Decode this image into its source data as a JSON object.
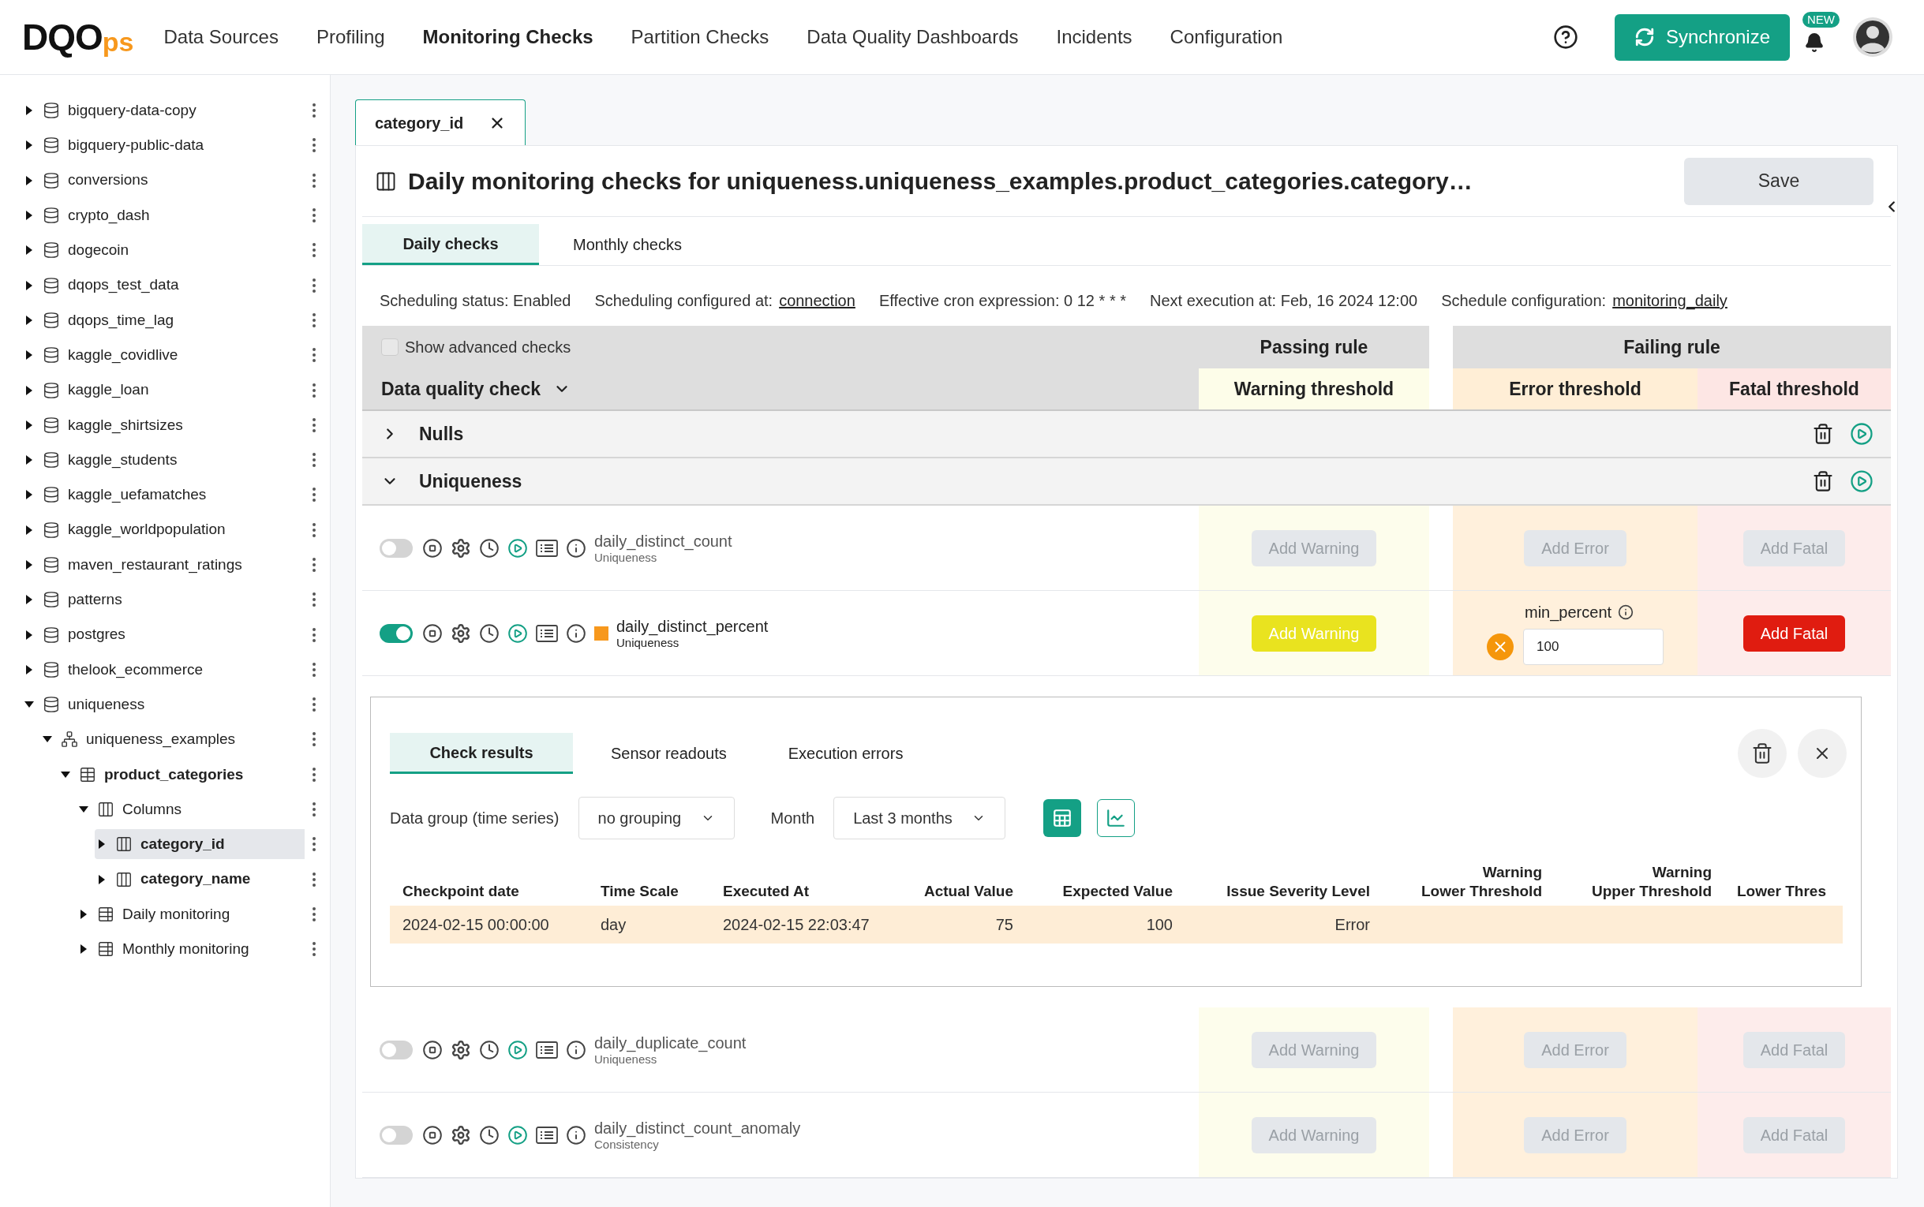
{
  "header": {
    "logo": {
      "text": "DQO",
      "suffix": "ps"
    },
    "nav": [
      {
        "label": "Data Sources",
        "selected": false
      },
      {
        "label": "Profiling",
        "selected": false
      },
      {
        "label": "Monitoring Checks",
        "selected": true
      },
      {
        "label": "Partition Checks",
        "selected": false
      },
      {
        "label": "Data Quality Dashboards",
        "selected": false
      },
      {
        "label": "Incidents",
        "selected": false
      },
      {
        "label": "Configuration",
        "selected": false
      }
    ],
    "sync_button": "Synchronize",
    "badge": "NEW"
  },
  "sidebar": {
    "items": [
      {
        "label": "bigquery-data-copy",
        "kind": "database",
        "expanded": false,
        "selected": false
      },
      {
        "label": "bigquery-public-data",
        "kind": "database",
        "expanded": false,
        "selected": false
      },
      {
        "label": "conversions",
        "kind": "database",
        "expanded": false,
        "selected": false
      },
      {
        "label": "crypto_dash",
        "kind": "database",
        "expanded": false,
        "selected": false
      },
      {
        "label": "dogecoin",
        "kind": "database",
        "expanded": false,
        "selected": false
      },
      {
        "label": "dqops_test_data",
        "kind": "database",
        "expanded": false,
        "selected": false
      },
      {
        "label": "dqops_time_lag",
        "kind": "database",
        "expanded": false,
        "selected": false
      },
      {
        "label": "kaggle_covidlive",
        "kind": "database",
        "expanded": false,
        "selected": false
      },
      {
        "label": "kaggle_loan",
        "kind": "database",
        "expanded": false,
        "selected": false
      },
      {
        "label": "kaggle_shirtsizes",
        "kind": "database",
        "expanded": false,
        "selected": false
      },
      {
        "label": "kaggle_students",
        "kind": "database",
        "expanded": false,
        "selected": false
      },
      {
        "label": "kaggle_uefamatches",
        "kind": "database",
        "expanded": false,
        "selected": false
      },
      {
        "label": "kaggle_worldpopulation",
        "kind": "database",
        "expanded": false,
        "selected": false
      },
      {
        "label": "maven_restaurant_ratings",
        "kind": "database",
        "expanded": false,
        "selected": false
      },
      {
        "label": "patterns",
        "kind": "database",
        "expanded": false,
        "selected": false
      },
      {
        "label": "postgres",
        "kind": "database",
        "expanded": false,
        "selected": false
      },
      {
        "label": "thelook_ecommerce",
        "kind": "database",
        "expanded": false,
        "selected": false
      },
      {
        "label": "uniqueness",
        "kind": "database",
        "expanded": true,
        "selected": false,
        "children": [
          {
            "label": "uniqueness_examples",
            "kind": "schema",
            "expanded": true,
            "selected": false,
            "children": [
              {
                "label": "product_categories",
                "kind": "table",
                "expanded": true,
                "selected": false,
                "children": [
                  {
                    "label": "Columns",
                    "kind": "columns",
                    "expanded": true,
                    "selected": false,
                    "children": [
                      {
                        "label": "category_id",
                        "kind": "column",
                        "expanded": false,
                        "selected": true
                      },
                      {
                        "label": "category_name",
                        "kind": "column",
                        "expanded": false,
                        "selected": false
                      }
                    ]
                  },
                  {
                    "label": "Daily monitoring",
                    "kind": "monitoring",
                    "expanded": false,
                    "selected": false
                  },
                  {
                    "label": "Monthly monitoring",
                    "kind": "monitoring",
                    "expanded": false,
                    "selected": false
                  }
                ]
              }
            ]
          }
        ]
      }
    ]
  },
  "open_tab": {
    "label": "category_id"
  },
  "panel": {
    "title": "Daily monitoring checks for uniqueness.uniqueness_examples.product_categories.category…",
    "save_button": "Save",
    "tabs": [
      {
        "label": "Daily checks",
        "selected": true
      },
      {
        "label": "Monthly checks",
        "selected": false
      }
    ],
    "schedule": [
      {
        "label": "Scheduling status: Enabled"
      },
      {
        "label": "Scheduling configured at:",
        "link": "connection"
      },
      {
        "label": "Effective cron expression: 0 12 * * *"
      },
      {
        "label": "Next execution at: Feb, 16 2024 12:00"
      },
      {
        "label": "Schedule configuration:",
        "link": "monitoring_daily"
      }
    ],
    "table_header": {
      "advanced_checkbox": {
        "label": "Show advanced checks",
        "checked": false
      },
      "check_column": "Data quality check",
      "passing_rule": "Passing rule",
      "failing_rule": "Failing rule",
      "warning": "Warning threshold",
      "error": "Error threshold",
      "fatal": "Fatal threshold"
    },
    "groups": [
      {
        "name": "Nulls",
        "expanded": false
      },
      {
        "name": "Uniqueness",
        "expanded": true,
        "checks": [
          {
            "name": "daily_distinct_count",
            "category": "Uniqueness",
            "enabled": false,
            "result_marker": false,
            "warning": {
              "kind": "add",
              "label": "Add Warning",
              "active": false
            },
            "error": {
              "kind": "add",
              "label": "Add Error",
              "active": false
            },
            "fatal": {
              "kind": "add",
              "label": "Add Fatal",
              "active": false
            }
          },
          {
            "name": "daily_distinct_percent",
            "category": "Uniqueness",
            "enabled": true,
            "result_marker": true,
            "warning": {
              "kind": "add",
              "label": "Add Warning",
              "active": true
            },
            "error": {
              "kind": "rule",
              "param": "min_percent",
              "value": "100"
            },
            "fatal": {
              "kind": "add",
              "label": "Add Fatal",
              "active": true
            },
            "results": {
              "tabs": [
                {
                  "label": "Check results",
                  "selected": true
                },
                {
                  "label": "Sensor readouts",
                  "selected": false
                },
                {
                  "label": "Execution errors",
                  "selected": false
                }
              ],
              "group_label": "Data group (time series)",
              "group_value": "no grouping",
              "period_label": "Month",
              "period_value": "Last 3 months",
              "views": [
                {
                  "kind": "table",
                  "selected": true
                },
                {
                  "kind": "chart",
                  "selected": false
                }
              ],
              "columns": [
                "Checkpoint date",
                "Time Scale",
                "Executed At",
                "Actual Value",
                "Expected Value",
                "Issue Severity Level",
                "Warning\nLower Threshold",
                "Warning\nUpper Threshold",
                "Lower Thres"
              ],
              "rows": [
                {
                  "cells": [
                    "2024-02-15 00:00:00",
                    "day",
                    "2024-02-15 22:03:47",
                    "75",
                    "100",
                    "Error"
                  ]
                }
              ]
            }
          },
          {
            "name": "daily_duplicate_count",
            "category": "Uniqueness",
            "enabled": false,
            "result_marker": false,
            "warning": {
              "kind": "add",
              "label": "Add Warning",
              "active": false
            },
            "error": {
              "kind": "add",
              "label": "Add Error",
              "active": false
            },
            "fatal": {
              "kind": "add",
              "label": "Add Fatal",
              "active": false
            }
          },
          {
            "name": "daily_distinct_count_anomaly",
            "category": "Consistency",
            "enabled": false,
            "result_marker": false,
            "warning": {
              "kind": "add",
              "label": "Add Warning",
              "active": false
            },
            "error": {
              "kind": "add",
              "label": "Add Error",
              "active": false
            },
            "fatal": {
              "kind": "add",
              "label": "Add Fatal",
              "active": false
            }
          }
        ]
      }
    ]
  }
}
